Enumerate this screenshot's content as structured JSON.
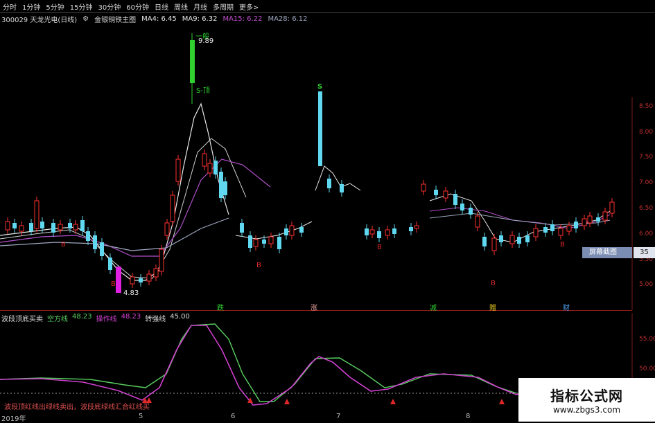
{
  "toolbar": {
    "tabs": [
      "分时",
      "1分钟",
      "5分钟",
      "15分钟",
      "30分钟",
      "60分钟",
      "日线",
      "周线",
      "月线",
      "多周期",
      "更多>"
    ]
  },
  "info": {
    "stock": "300029 天龙光电(日线)",
    "indicator": "金银铜铁主图",
    "ma4": "MA4: 6.45",
    "ma9": "MA9: 6.32",
    "ma15": "MA15: 6.22",
    "ma28": "MA28: 6.12"
  },
  "price_axis": [
    "8.50",
    "8.00",
    "7.50",
    "7.00",
    "6.50",
    "6.00",
    "5.50",
    "5.00"
  ],
  "sub_axis": [
    "55.00",
    "50.00"
  ],
  "labels": {
    "peak_tag": "一般",
    "peak_price": "9.89",
    "top_tag": "S-顶",
    "low_price": "4.83",
    "s_mark": "S",
    "b_mark": "B"
  },
  "event_marks": [
    "跌",
    "涨",
    "减",
    "赠",
    "财"
  ],
  "sticker": {
    "label": "屏幕截图",
    "value": "35"
  },
  "sub_panel": {
    "name": "波段顶底买卖",
    "line1": "空方线",
    "line1_value": "48.23",
    "line2": "操作线",
    "line2_value": "48.23",
    "line3": "转强线",
    "line3_value": "45.00"
  },
  "bottom_note": "波段顶红线出绿线卖出，波段底绿线汇合红线买",
  "x_dates": [
    "2019年",
    "5",
    "6",
    "7",
    "8"
  ],
  "watermark": {
    "title": "指标公式网",
    "url": "www.zbgs3.com"
  },
  "colors": {
    "up": "#ff3030",
    "down": "#5fd8f0",
    "ma_white": "#e8e8e8",
    "ma_purple": "#b050c8",
    "ma_gray": "#a0a8c0",
    "sub_green": "#58d060",
    "sub_magenta": "#d040d0",
    "accent_magenta": "#e020e0",
    "accent_green": "#30d030"
  }
}
